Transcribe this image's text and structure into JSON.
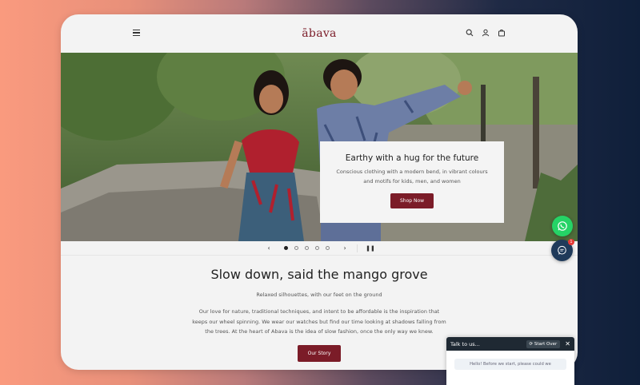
{
  "brand": {
    "logo": "ābava",
    "accent": "#7b1c28"
  },
  "header": {
    "icons": [
      "menu-icon",
      "search-icon",
      "account-icon",
      "cart-icon"
    ]
  },
  "hero": {
    "title": "Earthy with a hug for the future",
    "subtitle": "Conscious clothing with a modern bend, in vibrant colours and motifs for kids, men, and women",
    "button": "Shop Now"
  },
  "slider": {
    "prev": "‹",
    "next": "›",
    "pause": "❚❚",
    "slide_count": 5,
    "active_slide": 1
  },
  "story": {
    "title": "Slow down, said the mango grove",
    "tagline": "Relaxed silhouettes, with our feet on the ground",
    "body": "Our love for nature, traditional techniques, and intent to be affordable is the inspiration that keeps our wheel spinning. We wear our watches but find our time looking at shadows falling from the trees. At the heart of Abava is the idea of slow fashion, once the only way we knew.",
    "button": "Our Story"
  },
  "widgets": {
    "whatsapp_color": "#25d366",
    "chat_badge": "1"
  },
  "chat": {
    "title": "Talk to us...",
    "start_over": "⟳ Start Over",
    "close": "✕",
    "message": "Hello! Before we start, please could we"
  }
}
